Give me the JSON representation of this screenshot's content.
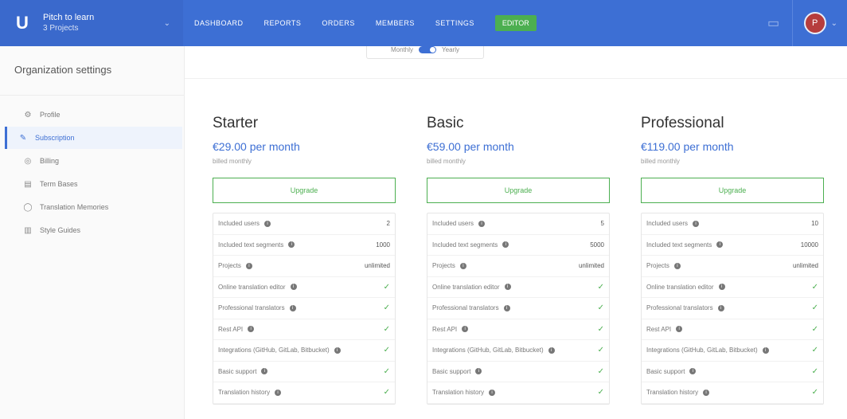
{
  "topbar": {
    "org_name": "Pitch to learn",
    "org_sub": "3 Projects",
    "nav": [
      "DASHBOARD",
      "REPORTS",
      "ORDERS",
      "MEMBERS",
      "SETTINGS"
    ],
    "editor_label": "EDITOR",
    "avatar_initial": "P",
    "brand_color": "#3d6fd4",
    "editor_color": "#4caf50"
  },
  "sidebar": {
    "title": "Organization settings",
    "items": [
      {
        "label": "Profile",
        "icon": "gear-icon",
        "active": false
      },
      {
        "label": "Subscription",
        "icon": "wrench-icon",
        "active": true
      },
      {
        "label": "Billing",
        "icon": "globe-icon",
        "active": false
      },
      {
        "label": "Term Bases",
        "icon": "book-icon",
        "active": false
      },
      {
        "label": "Translation Memories",
        "icon": "memory-icon",
        "active": false
      },
      {
        "label": "Style Guides",
        "icon": "guide-icon",
        "active": false
      }
    ]
  },
  "toggle": {
    "left": "Monthly",
    "right": "Yearly"
  },
  "plans": [
    {
      "name": "Starter",
      "price": "€29.00 per month",
      "billed": "billed monthly",
      "button": "Upgrade",
      "features": [
        {
          "label": "Included users",
          "value": "2"
        },
        {
          "label": "Included text segments",
          "value": "1000"
        },
        {
          "label": "Projects",
          "value": "unlimited"
        },
        {
          "label": "Online translation editor",
          "value": "✓"
        },
        {
          "label": "Professional translators",
          "value": "✓"
        },
        {
          "label": "Rest API",
          "value": "✓"
        },
        {
          "label": "Integrations (GitHub, GitLab, Bitbucket)",
          "value": "✓"
        },
        {
          "label": "Basic support",
          "value": "✓"
        },
        {
          "label": "Translation history",
          "value": "✓"
        }
      ]
    },
    {
      "name": "Basic",
      "price": "€59.00 per month",
      "billed": "billed monthly",
      "button": "Upgrade",
      "features": [
        {
          "label": "Included users",
          "value": "5"
        },
        {
          "label": "Included text segments",
          "value": "5000"
        },
        {
          "label": "Projects",
          "value": "unlimited"
        },
        {
          "label": "Online translation editor",
          "value": "✓"
        },
        {
          "label": "Professional translators",
          "value": "✓"
        },
        {
          "label": "Rest API",
          "value": "✓"
        },
        {
          "label": "Integrations (GitHub, GitLab, Bitbucket)",
          "value": "✓"
        },
        {
          "label": "Basic support",
          "value": "✓"
        },
        {
          "label": "Translation history",
          "value": "✓"
        }
      ]
    },
    {
      "name": "Professional",
      "price": "€119.00 per month",
      "billed": "billed monthly",
      "button": "Upgrade",
      "features": [
        {
          "label": "Included users",
          "value": "10"
        },
        {
          "label": "Included text segments",
          "value": "10000"
        },
        {
          "label": "Projects",
          "value": "unlimited"
        },
        {
          "label": "Online translation editor",
          "value": "✓"
        },
        {
          "label": "Professional translators",
          "value": "✓"
        },
        {
          "label": "Rest API",
          "value": "✓"
        },
        {
          "label": "Integrations (GitHub, GitLab, Bitbucket)",
          "value": "✓"
        },
        {
          "label": "Basic support",
          "value": "✓"
        },
        {
          "label": "Translation history",
          "value": "✓"
        }
      ]
    }
  ]
}
